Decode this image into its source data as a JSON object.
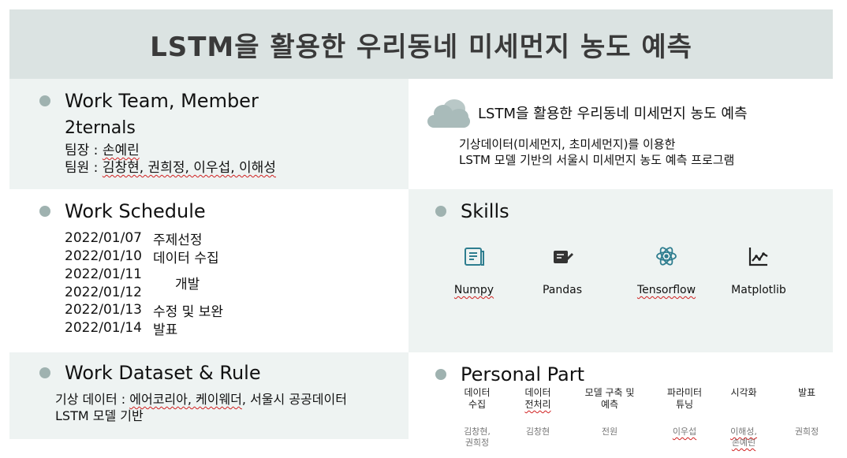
{
  "banner": {
    "title": "LSTM을 활용한 우리동네 미세먼지 농도 예측"
  },
  "team": {
    "heading": "Work Team, Member",
    "name": "2ternals",
    "leader_label": "팀장 : ",
    "leader": "손예린",
    "members_label": "팀원 : ",
    "members": "김창현, 권희정, 이우섭, 이해성"
  },
  "about": {
    "title": "LSTM을 활용한 우리동네 미세먼지 농도 예측",
    "desc_line1": "기상데이터(미세먼지, 초미세먼지)를 이용한",
    "desc_line2": "LSTM 모델 기반의 서울시 미세먼지 농도 예측 프로그램",
    "icon": "cloud-icon"
  },
  "schedule": {
    "heading": "Work Schedule",
    "dates": [
      "2022/01/07",
      "2022/01/10",
      "2022/01/11",
      "2022/01/12",
      "2022/01/13",
      "2022/01/14"
    ],
    "tasks": {
      "t1": "주제선정",
      "t2": "데이터 수집",
      "t3": "개발",
      "t4": "수정 및 보완",
      "t5": "발표"
    }
  },
  "skills": {
    "heading": "Skills",
    "items": [
      {
        "label": "Numpy",
        "icon": "numpy-icon"
      },
      {
        "label": "Pandas",
        "icon": "pandas-icon"
      },
      {
        "label": "Tensorflow",
        "icon": "atom-icon"
      },
      {
        "label": "Matplotlib",
        "icon": "line-chart-icon"
      }
    ]
  },
  "dataset": {
    "heading": "Work Dataset & Rule",
    "line1_prefix": "기상 데이터 : ",
    "line1_sources": "에어코리아, 케이웨더",
    "line1_suffix": ", 서울시 공공데이터",
    "line2": "LSTM 모델 기반"
  },
  "personal": {
    "heading": "Personal Part",
    "parts": [
      {
        "task_l1": "데이터",
        "task_l2": "수집",
        "who_l1": "김창현,",
        "who_l2": "권희정"
      },
      {
        "task_l1": "데이터",
        "task_l2": "전처리",
        "who_l1": "김창현",
        "who_l2": ""
      },
      {
        "task_l1": "모델 구축 및",
        "task_l2": "예측",
        "who_l1": "전원",
        "who_l2": ""
      },
      {
        "task_l1": "파라미터",
        "task_l2": "튜닝",
        "who_l1": "이우섭",
        "who_l2": ""
      },
      {
        "task_l1": "시각화",
        "task_l2": "",
        "who_l1": "이해성,",
        "who_l2": "손예린"
      },
      {
        "task_l1": "발표",
        "task_l2": "",
        "who_l1": "권희정",
        "who_l2": ""
      }
    ]
  },
  "colors": {
    "banner_bg": "#dbe3e2",
    "panel_bg": "#eef3f2",
    "bullet": "#9fb2b0",
    "icon": "#2e7d8f"
  }
}
